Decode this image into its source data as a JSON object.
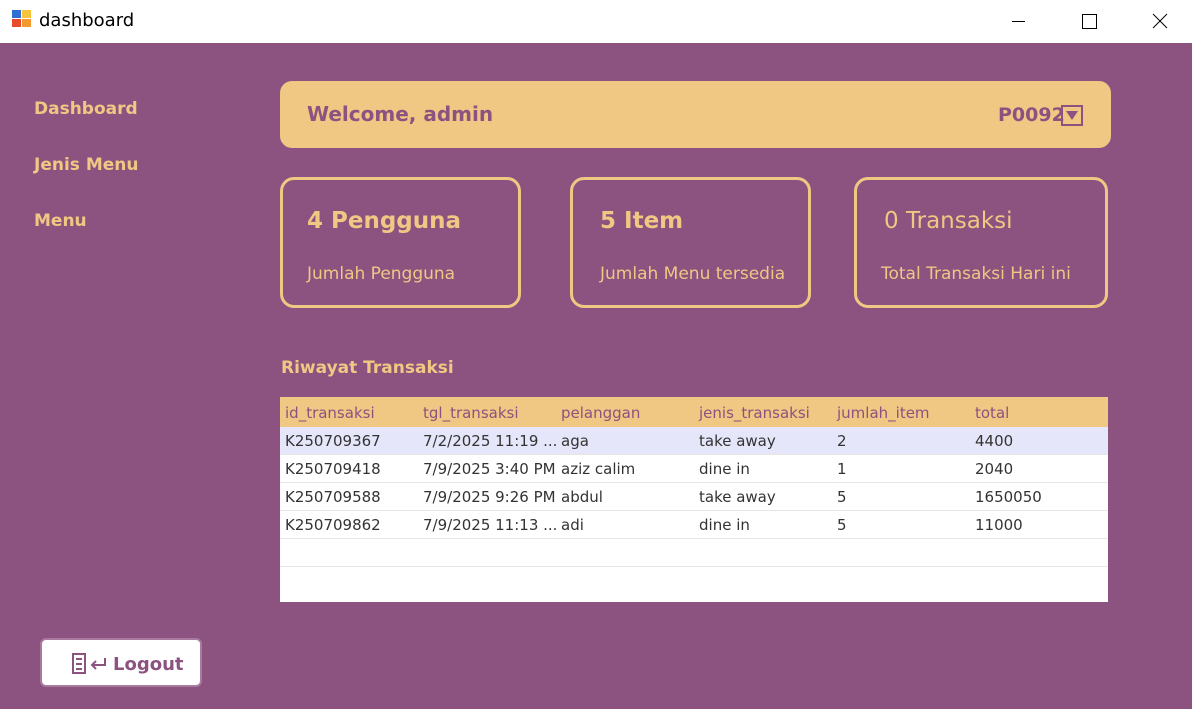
{
  "window": {
    "title": "dashboard"
  },
  "sidebar": {
    "items": [
      {
        "label": "Dashboard"
      },
      {
        "label": "Jenis Menu"
      },
      {
        "label": "Menu"
      }
    ]
  },
  "header": {
    "welcome": "Welcome, admin",
    "user_id": "P0092"
  },
  "cards": [
    {
      "value": "4 Pengguna",
      "label": "Jumlah Pengguna"
    },
    {
      "value": "5 Item",
      "label": "Jumlah Menu tersedia"
    },
    {
      "value": "0 Transaksi",
      "label": "Total Transaksi Hari ini"
    }
  ],
  "history": {
    "title": "Riwayat Transaksi",
    "columns": [
      "id_transaksi",
      "tgl_transaksi",
      "pelanggan",
      "jenis_transaksi",
      "jumlah_item",
      "total"
    ],
    "rows": [
      [
        "K250709367",
        "7/2/2025 11:19 ...",
        "aga",
        "take away",
        "2",
        "4400"
      ],
      [
        "K250709418",
        "7/9/2025 3:40 PM",
        "aziz calim",
        "dine in",
        "1",
        "2040"
      ],
      [
        "K250709588",
        "7/9/2025 9:26 PM",
        "abdul",
        "take away",
        "5",
        "1650050"
      ],
      [
        "K250709862",
        "7/9/2025 11:13 ...",
        "adi",
        "dine in",
        "5",
        "11000"
      ]
    ]
  },
  "logout": {
    "label": "Logout"
  },
  "colors": {
    "background": "#8c5280",
    "accent": "#f0c783",
    "selected_row": "#e6e6fa"
  },
  "icons": {
    "app": "app-icon",
    "dropdown": "chevron-down-icon",
    "logout": "logout-icon"
  }
}
